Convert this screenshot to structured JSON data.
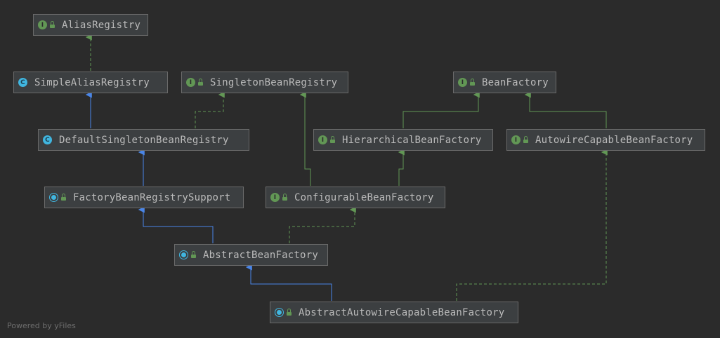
{
  "diagram": {
    "nodes": {
      "alias_registry": {
        "name": "AliasRegistry",
        "kind": "interface",
        "kind_glyph": "I"
      },
      "simple_alias_registry": {
        "name": "SimpleAliasRegistry",
        "kind": "class",
        "kind_glyph": "C"
      },
      "singleton_bean_registry": {
        "name": "SingletonBeanRegistry",
        "kind": "interface",
        "kind_glyph": "I"
      },
      "bean_factory": {
        "name": "BeanFactory",
        "kind": "interface",
        "kind_glyph": "I"
      },
      "default_singleton_bean_registry": {
        "name": "DefaultSingletonBeanRegistry",
        "kind": "class",
        "kind_glyph": "C"
      },
      "hierarchical_bean_factory": {
        "name": "HierarchicalBeanFactory",
        "kind": "interface",
        "kind_glyph": "I"
      },
      "autowire_capable_bean_factory": {
        "name": "AutowireCapableBeanFactory",
        "kind": "interface",
        "kind_glyph": "I"
      },
      "factory_bean_registry_support": {
        "name": "FactoryBeanRegistrySupport",
        "kind": "abstract",
        "kind_glyph": ""
      },
      "configurable_bean_factory": {
        "name": "ConfigurableBeanFactory",
        "kind": "interface",
        "kind_glyph": "I"
      },
      "abstract_bean_factory": {
        "name": "AbstractBeanFactory",
        "kind": "abstract",
        "kind_glyph": ""
      },
      "abstract_autowire_capable_bean_factory": {
        "name": "AbstractAutowireCapableBeanFactory",
        "kind": "abstract",
        "kind_glyph": ""
      }
    },
    "edges": [
      {
        "from": "simple_alias_registry",
        "to": "alias_registry",
        "type": "implements"
      },
      {
        "from": "default_singleton_bean_registry",
        "to": "simple_alias_registry",
        "type": "extends"
      },
      {
        "from": "default_singleton_bean_registry",
        "to": "singleton_bean_registry",
        "type": "implements"
      },
      {
        "from": "factory_bean_registry_support",
        "to": "default_singleton_bean_registry",
        "type": "extends"
      },
      {
        "from": "hierarchical_bean_factory",
        "to": "bean_factory",
        "type": "interface-extends"
      },
      {
        "from": "autowire_capable_bean_factory",
        "to": "bean_factory",
        "type": "interface-extends"
      },
      {
        "from": "configurable_bean_factory",
        "to": "hierarchical_bean_factory",
        "type": "interface-extends"
      },
      {
        "from": "configurable_bean_factory",
        "to": "singleton_bean_registry",
        "type": "interface-extends"
      },
      {
        "from": "abstract_bean_factory",
        "to": "factory_bean_registry_support",
        "type": "extends"
      },
      {
        "from": "abstract_bean_factory",
        "to": "configurable_bean_factory",
        "type": "implements"
      },
      {
        "from": "abstract_autowire_capable_bean_factory",
        "to": "abstract_bean_factory",
        "type": "extends"
      },
      {
        "from": "abstract_autowire_capable_bean_factory",
        "to": "autowire_capable_bean_factory",
        "type": "implements"
      }
    ],
    "colors": {
      "background": "#2b2b2b",
      "node_fill": "#3c3f41",
      "node_border": "#6a6a6a",
      "text": "#bbbbbb",
      "interface_badge": "#629755",
      "class_badge": "#40b6e0",
      "extends_edge": "#4a86e8",
      "implements_edge": "#629755"
    }
  },
  "footer": {
    "text": "Powered by yFiles"
  }
}
